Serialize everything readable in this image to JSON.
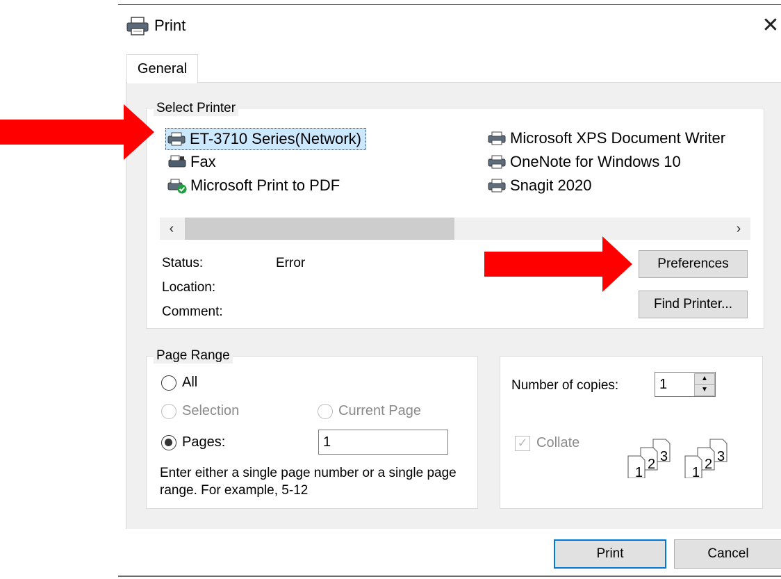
{
  "dialog": {
    "title": "Print",
    "close_glyph": "✕",
    "icon": "printer-icon"
  },
  "tabs": [
    {
      "label": "General"
    }
  ],
  "select_printer": {
    "legend": "Select Printer",
    "printers": [
      {
        "name": "ET-3710 Series(Network)",
        "selected": true,
        "icon": "printer-icon"
      },
      {
        "name": "Fax",
        "selected": false,
        "icon": "fax-icon"
      },
      {
        "name": "Microsoft Print to PDF",
        "selected": false,
        "icon": "default-printer-icon"
      },
      {
        "name": "Microsoft XPS Document Writer",
        "selected": false,
        "icon": "printer-icon"
      },
      {
        "name": "OneNote for Windows 10",
        "selected": false,
        "icon": "printer-icon"
      },
      {
        "name": "Snagit 2020",
        "selected": false,
        "icon": "printer-icon"
      }
    ],
    "status_label": "Status:",
    "status_value": "Error",
    "location_label": "Location:",
    "comment_label": "Comment:",
    "preferences_label": "Preferences",
    "find_printer_label": "Find Printer..."
  },
  "page_range": {
    "legend": "Page Range",
    "all_label": "All",
    "selection_label": "Selection",
    "current_page_label": "Current Page",
    "pages_label": "Pages:",
    "pages_value": "1",
    "selected_option": "Pages",
    "hint": "Enter either a single page number or a single page range.  For example, 5-12"
  },
  "copies": {
    "label": "Number of copies:",
    "value": "1",
    "collate_label": "Collate",
    "collate_checked": true,
    "collate_enabled": false,
    "collate_numbers": [
      "1",
      "2",
      "3"
    ]
  },
  "buttons": {
    "print_label": "Print",
    "cancel_label": "Cancel"
  },
  "annotations": {
    "arrow_color": "#ff0000"
  }
}
